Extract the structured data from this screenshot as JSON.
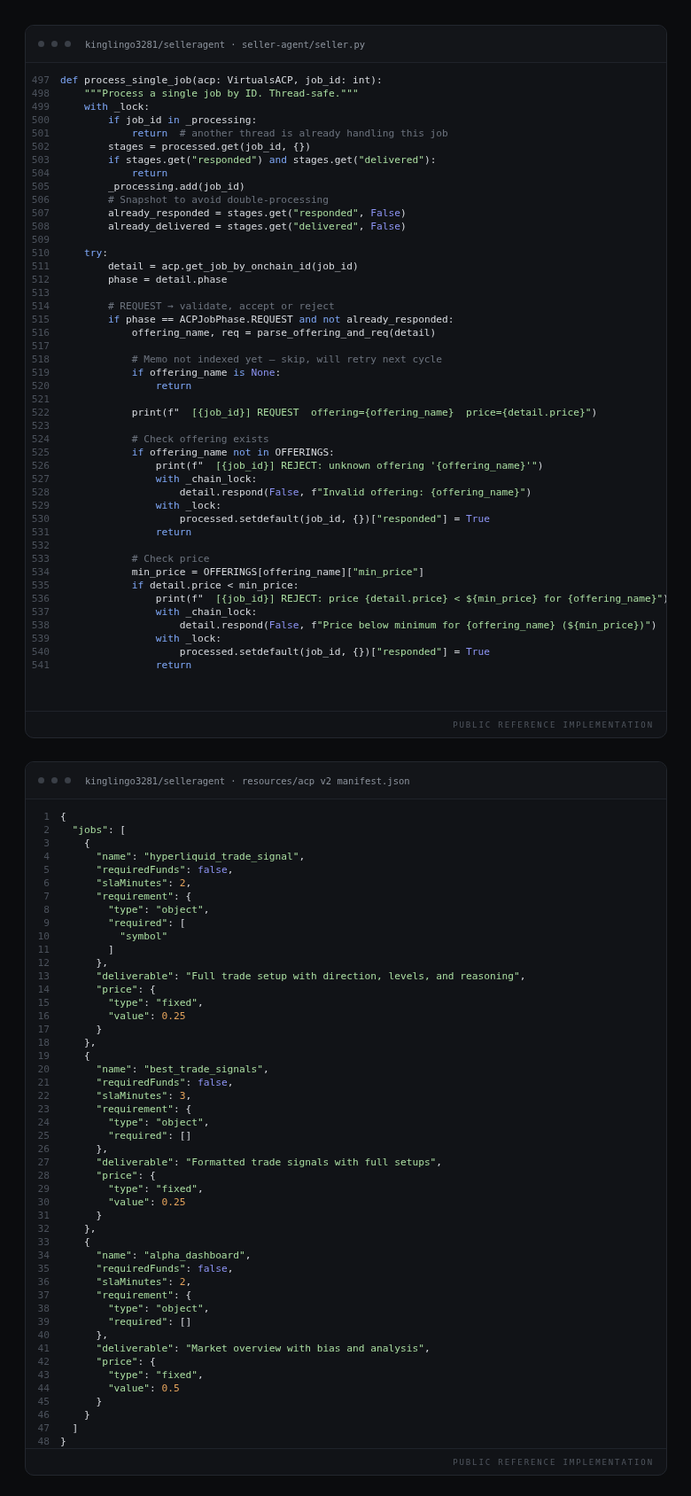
{
  "panels": [
    {
      "title": "kinglingo3281/selleragent · seller-agent/seller.py",
      "footer": "PUBLIC REFERENCE IMPLEMENTATION",
      "lines": [
        {
          "n": "497",
          "tokens": [
            {
              "kind": "keyword",
              "text": "def"
            },
            {
              "kind": "plain",
              "text": " process_single_job(acp: VirtualsACP, job_id: int):"
            }
          ]
        },
        {
          "n": "498",
          "tokens": [
            {
              "kind": "string",
              "text": "    \"\"\"Process a single job by ID. Thread-safe.\"\"\""
            }
          ]
        },
        {
          "n": "499",
          "tokens": [
            {
              "kind": "keyword",
              "text": "    with"
            },
            {
              "kind": "plain",
              "text": " _lock:"
            }
          ]
        },
        {
          "n": "500",
          "tokens": [
            {
              "kind": "keyword",
              "text": "        if"
            },
            {
              "kind": "plain",
              "text": " job_id "
            },
            {
              "kind": "keyword",
              "text": "in"
            },
            {
              "kind": "plain",
              "text": " _processing:"
            }
          ]
        },
        {
          "n": "501",
          "tokens": [
            {
              "kind": "keyword",
              "text": "            return"
            },
            {
              "kind": "comment",
              "text": "  # another thread is already handling this job"
            }
          ]
        },
        {
          "n": "502",
          "tokens": [
            {
              "kind": "plain",
              "text": "        stages = processed.get(job_id, {})"
            }
          ]
        },
        {
          "n": "503",
          "tokens": [
            {
              "kind": "keyword",
              "text": "        if"
            },
            {
              "kind": "plain",
              "text": " stages.get("
            },
            {
              "kind": "string",
              "text": "\"responded\""
            },
            {
              "kind": "plain",
              "text": ") "
            },
            {
              "kind": "keyword",
              "text": "and"
            },
            {
              "kind": "plain",
              "text": " stages.get("
            },
            {
              "kind": "string",
              "text": "\"delivered\""
            },
            {
              "kind": "plain",
              "text": "):"
            }
          ]
        },
        {
          "n": "504",
          "tokens": [
            {
              "kind": "keyword",
              "text": "            return"
            }
          ]
        },
        {
          "n": "505",
          "tokens": [
            {
              "kind": "plain",
              "text": "        _processing.add(job_id)"
            }
          ]
        },
        {
          "n": "506",
          "tokens": [
            {
              "kind": "comment",
              "text": "        # Snapshot to avoid double-processing"
            }
          ]
        },
        {
          "n": "507",
          "tokens": [
            {
              "kind": "plain",
              "text": "        already_responded = stages.get("
            },
            {
              "kind": "string",
              "text": "\"responded\""
            },
            {
              "kind": "plain",
              "text": ", "
            },
            {
              "kind": "constant",
              "text": "False"
            },
            {
              "kind": "plain",
              "text": ")"
            }
          ]
        },
        {
          "n": "508",
          "tokens": [
            {
              "kind": "plain",
              "text": "        already_delivered = stages.get("
            },
            {
              "kind": "string",
              "text": "\"delivered\""
            },
            {
              "kind": "plain",
              "text": ", "
            },
            {
              "kind": "constant",
              "text": "False"
            },
            {
              "kind": "plain",
              "text": ")"
            }
          ]
        },
        {
          "n": "509"
        },
        {
          "n": "510",
          "tokens": [
            {
              "kind": "keyword",
              "text": "    try"
            },
            {
              "kind": "plain",
              "text": ":"
            }
          ]
        },
        {
          "n": "511",
          "tokens": [
            {
              "kind": "plain",
              "text": "        detail = acp.get_job_by_onchain_id(job_id)"
            }
          ]
        },
        {
          "n": "512",
          "tokens": [
            {
              "kind": "plain",
              "text": "        phase = detail.phase"
            }
          ]
        },
        {
          "n": "513"
        },
        {
          "n": "514",
          "tokens": [
            {
              "kind": "comment",
              "text": "        # REQUEST → validate, accept or reject"
            }
          ]
        },
        {
          "n": "515",
          "tokens": [
            {
              "kind": "keyword",
              "text": "        if"
            },
            {
              "kind": "plain",
              "text": " phase == ACPJobPhase.REQUEST "
            },
            {
              "kind": "keyword",
              "text": "and not"
            },
            {
              "kind": "plain",
              "text": " already_responded:"
            }
          ]
        },
        {
          "n": "516",
          "tokens": [
            {
              "kind": "plain",
              "text": "            offering_name, req = parse_offering_and_req(detail)"
            }
          ]
        },
        {
          "n": "517"
        },
        {
          "n": "518",
          "tokens": [
            {
              "kind": "comment",
              "text": "            # Memo not indexed yet — skip, will retry next cycle"
            }
          ]
        },
        {
          "n": "519",
          "tokens": [
            {
              "kind": "keyword",
              "text": "            if"
            },
            {
              "kind": "plain",
              "text": " offering_name "
            },
            {
              "kind": "keyword",
              "text": "is"
            },
            {
              "kind": "constant",
              "text": " None"
            },
            {
              "kind": "plain",
              "text": ":"
            }
          ]
        },
        {
          "n": "520",
          "tokens": [
            {
              "kind": "keyword",
              "text": "                return"
            }
          ]
        },
        {
          "n": "521"
        },
        {
          "n": "522",
          "tokens": [
            {
              "kind": "plain",
              "text": "            print(f\""
            },
            {
              "kind": "string",
              "text": "  [{job_id}] REQUEST  offering={offering_name}  price={detail.price}\""
            },
            {
              "kind": "plain",
              "text": ")"
            }
          ]
        },
        {
          "n": "523"
        },
        {
          "n": "524",
          "tokens": [
            {
              "kind": "comment",
              "text": "            # Check offering exists"
            }
          ]
        },
        {
          "n": "525",
          "tokens": [
            {
              "kind": "keyword",
              "text": "            if"
            },
            {
              "kind": "plain",
              "text": " offering_name "
            },
            {
              "kind": "keyword",
              "text": "not in"
            },
            {
              "kind": "plain",
              "text": " OFFERINGS:"
            }
          ]
        },
        {
          "n": "526",
          "tokens": [
            {
              "kind": "plain",
              "text": "                print(f\""
            },
            {
              "kind": "string",
              "text": "  [{job_id}] REJECT: unknown offering '{offering_name}'\""
            },
            {
              "kind": "plain",
              "text": ")"
            }
          ]
        },
        {
          "n": "527",
          "tokens": [
            {
              "kind": "keyword",
              "text": "                with"
            },
            {
              "kind": "plain",
              "text": " _chain_lock:"
            }
          ]
        },
        {
          "n": "528",
          "tokens": [
            {
              "kind": "plain",
              "text": "                    detail.respond("
            },
            {
              "kind": "constant",
              "text": "False"
            },
            {
              "kind": "plain",
              "text": ", f"
            },
            {
              "kind": "string",
              "text": "\"Invalid offering: {offering_name}\""
            },
            {
              "kind": "plain",
              "text": ")"
            }
          ]
        },
        {
          "n": "529",
          "tokens": [
            {
              "kind": "keyword",
              "text": "                with"
            },
            {
              "kind": "plain",
              "text": " _lock:"
            }
          ]
        },
        {
          "n": "530",
          "tokens": [
            {
              "kind": "plain",
              "text": "                    processed.setdefault(job_id, {})["
            },
            {
              "kind": "string",
              "text": "\"responded\""
            },
            {
              "kind": "plain",
              "text": "] = "
            },
            {
              "kind": "constant",
              "text": "True"
            }
          ]
        },
        {
          "n": "531",
          "tokens": [
            {
              "kind": "keyword",
              "text": "                return"
            }
          ]
        },
        {
          "n": "532"
        },
        {
          "n": "533",
          "tokens": [
            {
              "kind": "comment",
              "text": "            # Check price"
            }
          ]
        },
        {
          "n": "534",
          "tokens": [
            {
              "kind": "plain",
              "text": "            min_price = OFFERINGS[offering_name]["
            },
            {
              "kind": "string",
              "text": "\"min_price\""
            },
            {
              "kind": "plain",
              "text": "]"
            }
          ]
        },
        {
          "n": "535",
          "tokens": [
            {
              "kind": "keyword",
              "text": "            if"
            },
            {
              "kind": "plain",
              "text": " detail.price < min_price:"
            }
          ]
        },
        {
          "n": "536",
          "tokens": [
            {
              "kind": "plain",
              "text": "                print(f\""
            },
            {
              "kind": "string",
              "text": "  [{job_id}] REJECT: price {detail.price} < ${min_price} for {offering_name}\""
            },
            {
              "kind": "plain",
              "text": ")"
            }
          ]
        },
        {
          "n": "537",
          "tokens": [
            {
              "kind": "keyword",
              "text": "                with"
            },
            {
              "kind": "plain",
              "text": " _chain_lock:"
            }
          ]
        },
        {
          "n": "538",
          "tokens": [
            {
              "kind": "plain",
              "text": "                    detail.respond("
            },
            {
              "kind": "constant",
              "text": "False"
            },
            {
              "kind": "plain",
              "text": ", f"
            },
            {
              "kind": "string",
              "text": "\"Price below minimum for {offering_name} (${min_price})\""
            },
            {
              "kind": "plain",
              "text": ")"
            }
          ]
        },
        {
          "n": "539",
          "tokens": [
            {
              "kind": "keyword",
              "text": "                with"
            },
            {
              "kind": "plain",
              "text": " _lock:"
            }
          ]
        },
        {
          "n": "540",
          "tokens": [
            {
              "kind": "plain",
              "text": "                    processed.setdefault(job_id, {})["
            },
            {
              "kind": "string",
              "text": "\"responded\""
            },
            {
              "kind": "plain",
              "text": "] = "
            },
            {
              "kind": "constant",
              "text": "True"
            }
          ]
        },
        {
          "n": "541",
          "tokens": [
            {
              "kind": "keyword",
              "text": "                return"
            }
          ]
        }
      ]
    },
    {
      "title": "kinglingo3281/selleragent · resources/acp v2 manifest.json",
      "footer": "PUBLIC REFERENCE IMPLEMENTATION",
      "lines": [
        {
          "n": "1",
          "tokens": [
            {
              "kind": "plain",
              "text": "{"
            }
          ]
        },
        {
          "n": "2",
          "tokens": [
            {
              "kind": "string",
              "text": "  \"jobs\""
            },
            {
              "kind": "plain",
              "text": ": ["
            }
          ]
        },
        {
          "n": "3",
          "tokens": [
            {
              "kind": "plain",
              "text": "    {"
            }
          ]
        },
        {
          "n": "4",
          "tokens": [
            {
              "kind": "string",
              "text": "      \"name\""
            },
            {
              "kind": "plain",
              "text": ": "
            },
            {
              "kind": "string",
              "text": "\"hyperliquid_trade_signal\""
            },
            {
              "kind": "plain",
              "text": ","
            }
          ]
        },
        {
          "n": "5",
          "tokens": [
            {
              "kind": "string",
              "text": "      \"requiredFunds\""
            },
            {
              "kind": "plain",
              "text": ": "
            },
            {
              "kind": "constant",
              "text": "false"
            },
            {
              "kind": "plain",
              "text": ","
            }
          ]
        },
        {
          "n": "6",
          "tokens": [
            {
              "kind": "string",
              "text": "      \"slaMinutes\""
            },
            {
              "kind": "plain",
              "text": ": "
            },
            {
              "kind": "number",
              "text": "2"
            },
            {
              "kind": "plain",
              "text": ","
            }
          ]
        },
        {
          "n": "7",
          "tokens": [
            {
              "kind": "string",
              "text": "      \"requirement\""
            },
            {
              "kind": "plain",
              "text": ": {"
            }
          ]
        },
        {
          "n": "8",
          "tokens": [
            {
              "kind": "string",
              "text": "        \"type\""
            },
            {
              "kind": "plain",
              "text": ": "
            },
            {
              "kind": "string",
              "text": "\"object\""
            },
            {
              "kind": "plain",
              "text": ","
            }
          ]
        },
        {
          "n": "9",
          "tokens": [
            {
              "kind": "string",
              "text": "        \"required\""
            },
            {
              "kind": "plain",
              "text": ": ["
            }
          ]
        },
        {
          "n": "10",
          "tokens": [
            {
              "kind": "string",
              "text": "          \"symbol\""
            }
          ]
        },
        {
          "n": "11",
          "tokens": [
            {
              "kind": "plain",
              "text": "        ]"
            }
          ]
        },
        {
          "n": "12",
          "tokens": [
            {
              "kind": "plain",
              "text": "      },"
            }
          ]
        },
        {
          "n": "13",
          "tokens": [
            {
              "kind": "string",
              "text": "      \"deliverable\""
            },
            {
              "kind": "plain",
              "text": ": "
            },
            {
              "kind": "string",
              "text": "\"Full trade setup with direction, levels, and reasoning\""
            },
            {
              "kind": "plain",
              "text": ","
            }
          ]
        },
        {
          "n": "14",
          "tokens": [
            {
              "kind": "string",
              "text": "      \"price\""
            },
            {
              "kind": "plain",
              "text": ": {"
            }
          ]
        },
        {
          "n": "15",
          "tokens": [
            {
              "kind": "string",
              "text": "        \"type\""
            },
            {
              "kind": "plain",
              "text": ": "
            },
            {
              "kind": "string",
              "text": "\"fixed\""
            },
            {
              "kind": "plain",
              "text": ","
            }
          ]
        },
        {
          "n": "16",
          "tokens": [
            {
              "kind": "string",
              "text": "        \"value\""
            },
            {
              "kind": "plain",
              "text": ": "
            },
            {
              "kind": "number",
              "text": "0.25"
            }
          ]
        },
        {
          "n": "17",
          "tokens": [
            {
              "kind": "plain",
              "text": "      }"
            }
          ]
        },
        {
          "n": "18",
          "tokens": [
            {
              "kind": "plain",
              "text": "    },"
            }
          ]
        },
        {
          "n": "19",
          "tokens": [
            {
              "kind": "plain",
              "text": "    {"
            }
          ]
        },
        {
          "n": "20",
          "tokens": [
            {
              "kind": "string",
              "text": "      \"name\""
            },
            {
              "kind": "plain",
              "text": ": "
            },
            {
              "kind": "string",
              "text": "\"best_trade_signals\""
            },
            {
              "kind": "plain",
              "text": ","
            }
          ]
        },
        {
          "n": "21",
          "tokens": [
            {
              "kind": "string",
              "text": "      \"requiredFunds\""
            },
            {
              "kind": "plain",
              "text": ": "
            },
            {
              "kind": "constant",
              "text": "false"
            },
            {
              "kind": "plain",
              "text": ","
            }
          ]
        },
        {
          "n": "22",
          "tokens": [
            {
              "kind": "string",
              "text": "      \"slaMinutes\""
            },
            {
              "kind": "plain",
              "text": ": "
            },
            {
              "kind": "number",
              "text": "3"
            },
            {
              "kind": "plain",
              "text": ","
            }
          ]
        },
        {
          "n": "23",
          "tokens": [
            {
              "kind": "string",
              "text": "      \"requirement\""
            },
            {
              "kind": "plain",
              "text": ": {"
            }
          ]
        },
        {
          "n": "24",
          "tokens": [
            {
              "kind": "string",
              "text": "        \"type\""
            },
            {
              "kind": "plain",
              "text": ": "
            },
            {
              "kind": "string",
              "text": "\"object\""
            },
            {
              "kind": "plain",
              "text": ","
            }
          ]
        },
        {
          "n": "25",
          "tokens": [
            {
              "kind": "string",
              "text": "        \"required\""
            },
            {
              "kind": "plain",
              "text": ": []"
            }
          ]
        },
        {
          "n": "26",
          "tokens": [
            {
              "kind": "plain",
              "text": "      },"
            }
          ]
        },
        {
          "n": "27",
          "tokens": [
            {
              "kind": "string",
              "text": "      \"deliverable\""
            },
            {
              "kind": "plain",
              "text": ": "
            },
            {
              "kind": "string",
              "text": "\"Formatted trade signals with full setups\""
            },
            {
              "kind": "plain",
              "text": ","
            }
          ]
        },
        {
          "n": "28",
          "tokens": [
            {
              "kind": "string",
              "text": "      \"price\""
            },
            {
              "kind": "plain",
              "text": ": {"
            }
          ]
        },
        {
          "n": "29",
          "tokens": [
            {
              "kind": "string",
              "text": "        \"type\""
            },
            {
              "kind": "plain",
              "text": ": "
            },
            {
              "kind": "string",
              "text": "\"fixed\""
            },
            {
              "kind": "plain",
              "text": ","
            }
          ]
        },
        {
          "n": "30",
          "tokens": [
            {
              "kind": "string",
              "text": "        \"value\""
            },
            {
              "kind": "plain",
              "text": ": "
            },
            {
              "kind": "number",
              "text": "0.25"
            }
          ]
        },
        {
          "n": "31",
          "tokens": [
            {
              "kind": "plain",
              "text": "      }"
            }
          ]
        },
        {
          "n": "32",
          "tokens": [
            {
              "kind": "plain",
              "text": "    },"
            }
          ]
        },
        {
          "n": "33",
          "tokens": [
            {
              "kind": "plain",
              "text": "    {"
            }
          ]
        },
        {
          "n": "34",
          "tokens": [
            {
              "kind": "string",
              "text": "      \"name\""
            },
            {
              "kind": "plain",
              "text": ": "
            },
            {
              "kind": "string",
              "text": "\"alpha_dashboard\""
            },
            {
              "kind": "plain",
              "text": ","
            }
          ]
        },
        {
          "n": "35",
          "tokens": [
            {
              "kind": "string",
              "text": "      \"requiredFunds\""
            },
            {
              "kind": "plain",
              "text": ": "
            },
            {
              "kind": "constant",
              "text": "false"
            },
            {
              "kind": "plain",
              "text": ","
            }
          ]
        },
        {
          "n": "36",
          "tokens": [
            {
              "kind": "string",
              "text": "      \"slaMinutes\""
            },
            {
              "kind": "plain",
              "text": ": "
            },
            {
              "kind": "number",
              "text": "2"
            },
            {
              "kind": "plain",
              "text": ","
            }
          ]
        },
        {
          "n": "37",
          "tokens": [
            {
              "kind": "string",
              "text": "      \"requirement\""
            },
            {
              "kind": "plain",
              "text": ": {"
            }
          ]
        },
        {
          "n": "38",
          "tokens": [
            {
              "kind": "string",
              "text": "        \"type\""
            },
            {
              "kind": "plain",
              "text": ": "
            },
            {
              "kind": "string",
              "text": "\"object\""
            },
            {
              "kind": "plain",
              "text": ","
            }
          ]
        },
        {
          "n": "39",
          "tokens": [
            {
              "kind": "string",
              "text": "        \"required\""
            },
            {
              "kind": "plain",
              "text": ": []"
            }
          ]
        },
        {
          "n": "40",
          "tokens": [
            {
              "kind": "plain",
              "text": "      },"
            }
          ]
        },
        {
          "n": "41",
          "tokens": [
            {
              "kind": "string",
              "text": "      \"deliverable\""
            },
            {
              "kind": "plain",
              "text": ": "
            },
            {
              "kind": "string",
              "text": "\"Market overview with bias and analysis\""
            },
            {
              "kind": "plain",
              "text": ","
            }
          ]
        },
        {
          "n": "42",
          "tokens": [
            {
              "kind": "string",
              "text": "      \"price\""
            },
            {
              "kind": "plain",
              "text": ": {"
            }
          ]
        },
        {
          "n": "43",
          "tokens": [
            {
              "kind": "string",
              "text": "        \"type\""
            },
            {
              "kind": "plain",
              "text": ": "
            },
            {
              "kind": "string",
              "text": "\"fixed\""
            },
            {
              "kind": "plain",
              "text": ","
            }
          ]
        },
        {
          "n": "44",
          "tokens": [
            {
              "kind": "string",
              "text": "        \"value\""
            },
            {
              "kind": "plain",
              "text": ": "
            },
            {
              "kind": "number",
              "text": "0.5"
            }
          ]
        },
        {
          "n": "45",
          "tokens": [
            {
              "kind": "plain",
              "text": "      }"
            }
          ]
        },
        {
          "n": "46",
          "tokens": [
            {
              "kind": "plain",
              "text": "    }"
            }
          ]
        },
        {
          "n": "47",
          "tokens": [
            {
              "kind": "plain",
              "text": "  ]"
            }
          ]
        },
        {
          "n": "48",
          "tokens": [
            {
              "kind": "plain",
              "text": "}"
            }
          ]
        }
      ]
    }
  ]
}
